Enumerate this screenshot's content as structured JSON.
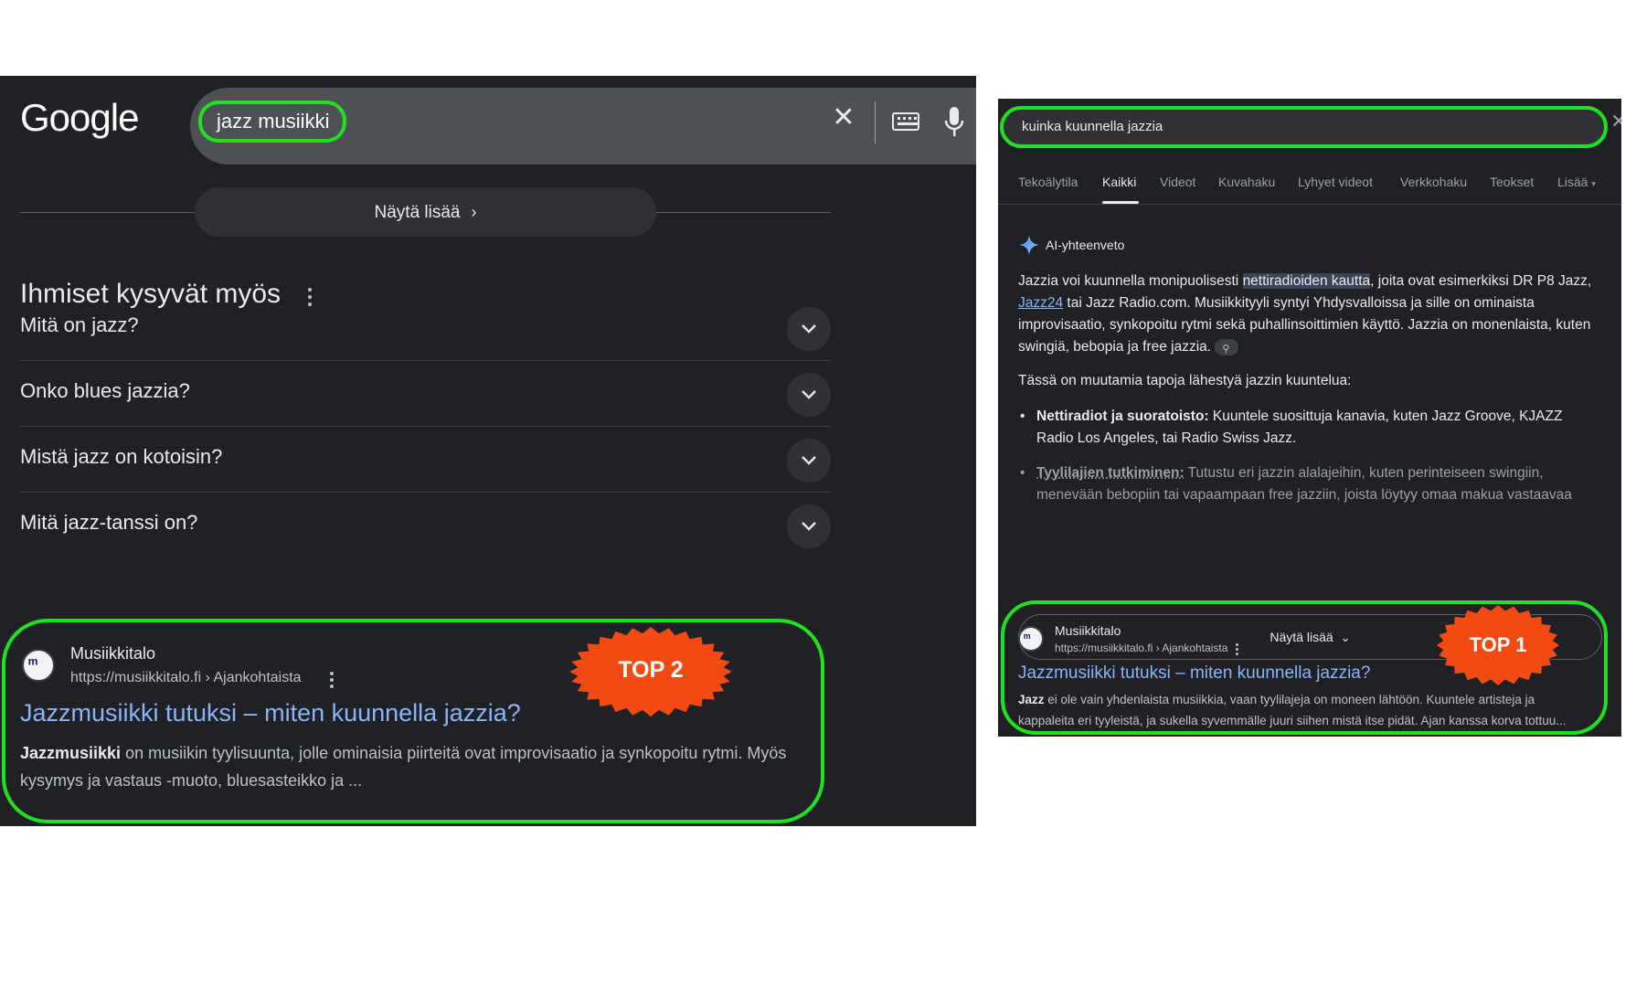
{
  "left_panel": {
    "logo": "Google",
    "search": {
      "query": "jazz musiikki"
    },
    "show_more_label": "Näytä lisää",
    "paa": {
      "title": "Ihmiset kysyvät myös",
      "questions": [
        "Mitä on jazz?",
        "Onko blues jazzia?",
        "Mistä jazz on kotoisin?",
        "Mitä jazz-tanssi on?"
      ]
    },
    "result": {
      "site_name": "Musiikkitalo",
      "url": "https://musiikkitalo.fi › Ajankohtaista",
      "title": "Jazzmusiikki tutuksi – miten kuunnella jazzia?",
      "snippet_bold": "Jazzmusiikki",
      "snippet_rest": " on musiikin tyylisuunta, jolle ominaisia piirteitä ovat improvisaatio ja synkopoitu rytmi. Myös kysymys ja vastaus -muoto, bluesasteikko ja ..."
    },
    "badge": "TOP 2"
  },
  "right_panel": {
    "search": {
      "query": "kuinka kuunnella jazzia"
    },
    "tabs": [
      "Tekoälytila",
      "Kaikki",
      "Videot",
      "Kuvahaku",
      "Lyhyet videot",
      "Verkkohaku",
      "Teokset",
      "Lisää"
    ],
    "active_tab": "Kaikki",
    "ai_overview": {
      "label": "AI-yhteenveto",
      "p1_a": "Jazzia voi kuunnella monipuolisesti ",
      "p1_highlight": "nettiradioiden kautta",
      "p1_b": ", joita ovat esimerkiksi DR P8 Jazz, ",
      "p1_link": "Jazz24",
      "p1_c": " tai Jazz Radio.com. Musiikkityyli syntyi Yhdysvalloissa ja sille on ominaista improvisaatio, synkopoitu rytmi sekä puhallinsoittimien käyttö. Jazzia on monenlaista, kuten swingiä, bebopia ja free jazzia.",
      "intro": "Tässä on muutamia tapoja lähestyä jazzin kuuntelua:",
      "b1_bold": "Nettiradiot ja suoratoisto:",
      "b1_rest": " Kuuntele suosittuja kanavia, kuten Jazz Groove, KJAZZ Radio Los Angeles, tai Radio Swiss Jazz.",
      "b2_bold": "Tyylilajien tutkiminen:",
      "b2_rest": " Tutustu eri jazzin alalajeihin, kuten perinteiseen swingiin, menevään bebopiin tai vapaampaan free jazziin, joista löytyy omaa makua vastaavaa",
      "show_more_label": "Näytä lisää"
    },
    "result": {
      "site_name": "Musiikkitalo",
      "url": "https://musiikkitalo.fi › Ajankohtaista",
      "title": "Jazzmusiikki tutuksi – miten kuunnella jazzia?",
      "snippet_bold": "Jazz",
      "snippet_rest": " ei ole vain yhdenlaista musiikkia, vaan tyylilajeja on moneen lähtöön. Kuuntele artisteja ja",
      "snippet_line2": "kappaleita eri tyyleistä, ja sukella syvemmälle juuri siihen mistä itse pidät. Ajan kanssa korva tottuu..."
    },
    "badge": "TOP 1"
  },
  "colors": {
    "highlight_green": "#21e021",
    "badge_orange": "#f24a12",
    "dark_bg": "#202124",
    "link_blue": "#8ab4f8"
  }
}
